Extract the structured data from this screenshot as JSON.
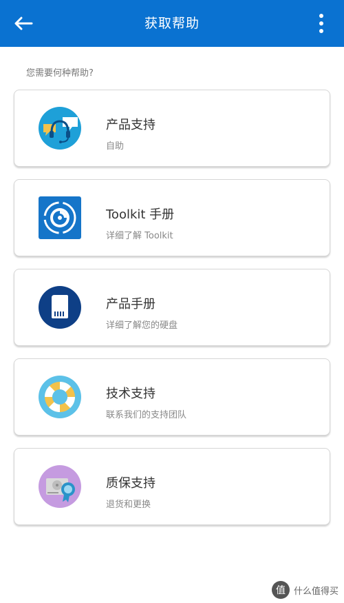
{
  "app_bar": {
    "title": "获取帮助",
    "back_icon": "arrow-left-icon",
    "menu_icon": "more-vertical-icon",
    "color": "#0a72d1"
  },
  "section_label": "您需要何种帮助?",
  "cards": [
    {
      "title": "产品支持",
      "subtitle": "自助",
      "icon": "headset-support-icon"
    },
    {
      "title": "Toolkit 手册",
      "subtitle": "详细了解 Toolkit",
      "icon": "toolkit-disc-icon"
    },
    {
      "title": "产品手册",
      "subtitle": "详细了解您的硬盘",
      "icon": "drive-manual-icon"
    },
    {
      "title": "技术支持",
      "subtitle": "联系我们的支持团队",
      "icon": "lifebuoy-icon"
    },
    {
      "title": "质保支持",
      "subtitle": "退货和更换",
      "icon": "warranty-badge-icon"
    }
  ],
  "watermark": {
    "logo_char": "值",
    "text": "什么值得买"
  }
}
